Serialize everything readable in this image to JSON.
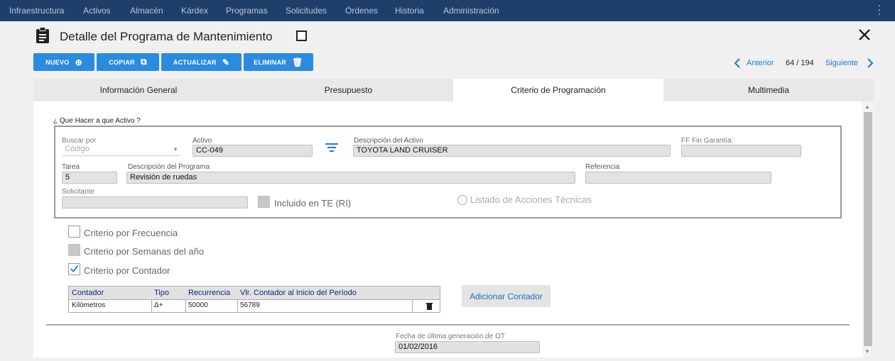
{
  "nav": {
    "items": [
      "Infraestructura",
      "Activos",
      "Almacén",
      "Kárdex",
      "Programas",
      "Solicitudes",
      "Órdenes",
      "Historia",
      "Administración"
    ]
  },
  "header": {
    "title": "Detalle del Programa de Mantenimiento"
  },
  "toolbar": {
    "nuevo": "NUEVO",
    "copiar": "COPIAR",
    "actualizar": "ACTUALIZAR",
    "eliminar": "ELIMINAR"
  },
  "pager": {
    "prev": "Anterior",
    "position": "64 / 194",
    "next": "Siguiente"
  },
  "tabs": [
    "Información General",
    "Presupuesto",
    "Criterio de Programación",
    "Multimedia"
  ],
  "active_tab": 2,
  "form": {
    "section_label": "¿ Que Hacer a que Activo ?",
    "buscar_por_label": "Buscar por",
    "buscar_por_value": "Código",
    "activo_label": "Activo",
    "activo_value": "CC-049",
    "desc_activo_label": "Descripción del Activo",
    "desc_activo_value": "TOYOTA LAND CRUISER",
    "ff_fin_label": "FF Fin Garantía:",
    "ff_fin_value": "",
    "tarea_label": "Tarea",
    "tarea_value": "5",
    "desc_programa_label": "Descripción del Programa",
    "desc_programa_value": "Revisión de ruedas",
    "referencia_label": "Referencia",
    "referencia_value": "",
    "solicitante_label": "Solicitante",
    "solicitante_value": "",
    "incluido_label": "Incluido en TE (RI)",
    "listado_label": "Listado de Acciones Técnicas"
  },
  "criteria": {
    "frecuencia": "Criterio por Frecuencia",
    "semanas": "Criterio por Semanas del año",
    "contador": "Criterio por Contador"
  },
  "counter_table": {
    "headers": [
      "Contador",
      "Tipo",
      "Recurrencia",
      "Vlr. Contador al Inicio del Período"
    ],
    "rows": [
      {
        "contador": "Kilómetros",
        "tipo": "Δ+",
        "recurrencia": "50000",
        "valor": "56789"
      }
    ]
  },
  "add_counter_label": "Adicionar Contador",
  "footer": {
    "fecha_label": "Fecha de última generación de OT",
    "fecha_value": "01/02/2016"
  },
  "colors": {
    "nav_bg": "#1f3f6b",
    "button_blue": "#2a8be0",
    "link_blue": "#1d78d8"
  }
}
